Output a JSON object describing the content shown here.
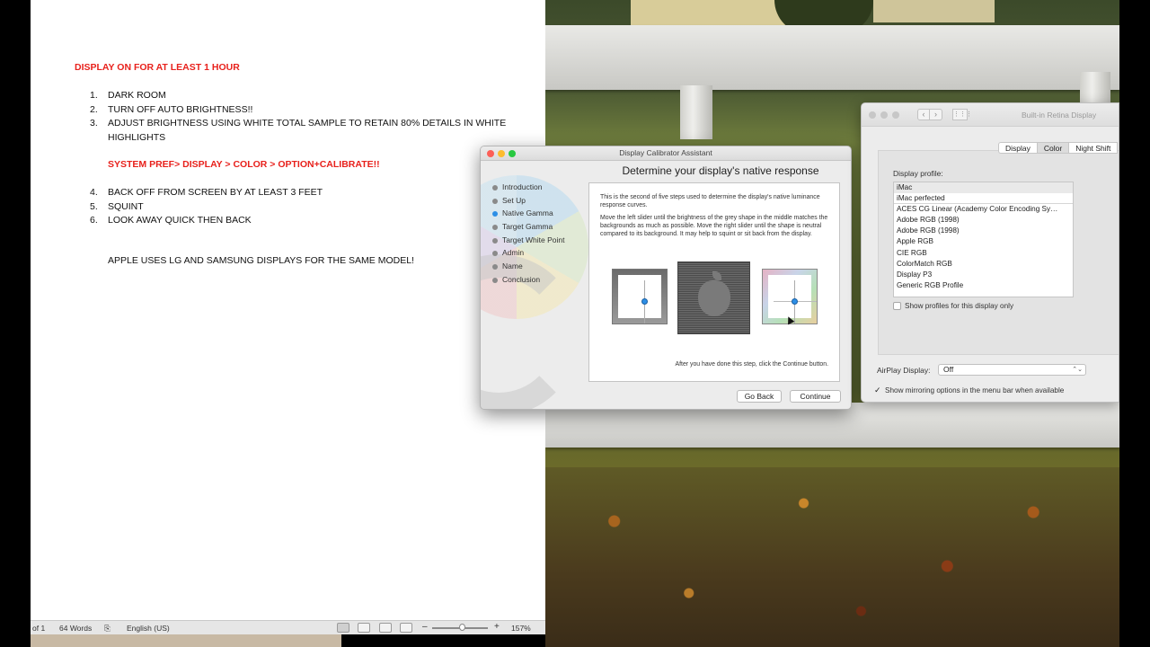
{
  "document": {
    "heading": "DISPLAY ON FOR AT LEAST 1 HOUR",
    "list1": [
      {
        "num": "1.",
        "text": "DARK ROOM"
      },
      {
        "num": "2.",
        "text": "TURN OFF AUTO BRIGHTNESS!!"
      },
      {
        "num": "3.",
        "text": "ADJUST BRIGHTNESS USING WHITE TOTAL SAMPLE TO RETAIN 80% DETAILS IN WHITE"
      },
      {
        "num": "",
        "text": "HIGHLIGHTS"
      }
    ],
    "redline": "SYSTEM PREF> DISPLAY > COLOR > OPTION+CALIBRATE!!",
    "list2": [
      {
        "num": "4.",
        "text": "BACK OFF FROM SCREEN BY AT LEAST 3 FEET"
      },
      {
        "num": "5.",
        "text": "SQUINT"
      },
      {
        "num": "6.",
        "text": "LOOK AWAY QUICK THEN BACK"
      }
    ],
    "note": "APPLE USES LG AND SAMSUNG DISPLAYS FOR THE SAME MODEL!"
  },
  "statusbar": {
    "page": "of 1",
    "words": "64 Words",
    "language": "English (US)",
    "zoom": "157%"
  },
  "calibrator": {
    "window_title": "Display Calibrator Assistant",
    "headline": "Determine your display's native response",
    "steps": [
      "Introduction",
      "Set Up",
      "Native Gamma",
      "Target Gamma",
      "Target White Point",
      "Admin",
      "Name",
      "Conclusion"
    ],
    "active_step": "Native Gamma",
    "paragraph1": "This is the second of five steps used to determine the display's native luminance response curves.",
    "paragraph2": "Move the left slider until the brightness of the grey shape in the middle matches the backgrounds as much as possible.  Move the right slider until the shape is neutral compared to its background.  It may help to squint or sit back from the display.",
    "after_text": "After you have done this step, click the Continue button.",
    "go_back": "Go Back",
    "continue": "Continue"
  },
  "system_prefs": {
    "window_title": "Built-in Retina Display",
    "tabs": [
      "Display",
      "Color",
      "Night Shift"
    ],
    "selected_tab": "Color",
    "profile_label": "Display profile:",
    "profiles": [
      "iMac",
      "iMac perfected",
      "ACES CG Linear (Academy Color Encoding Sy…",
      "Adobe RGB (1998)",
      "Adobe RGB (1998)",
      "Apple RGB",
      "CIE RGB",
      "ColorMatch RGB",
      "Display P3",
      "Generic RGB Profile"
    ],
    "show_profiles_label": "Show profiles for this display only",
    "airplay_label": "AirPlay Display:",
    "airplay_value": "Off",
    "mirroring_label": "Show mirroring options in the menu bar when available",
    "mirroring_checked": true
  },
  "colors": {
    "red_text": "#e8211c",
    "active_step": "#2d8fe6",
    "traffic_red": "#fc5f57",
    "traffic_yellow": "#fdbc2e",
    "traffic_green": "#28c840"
  }
}
